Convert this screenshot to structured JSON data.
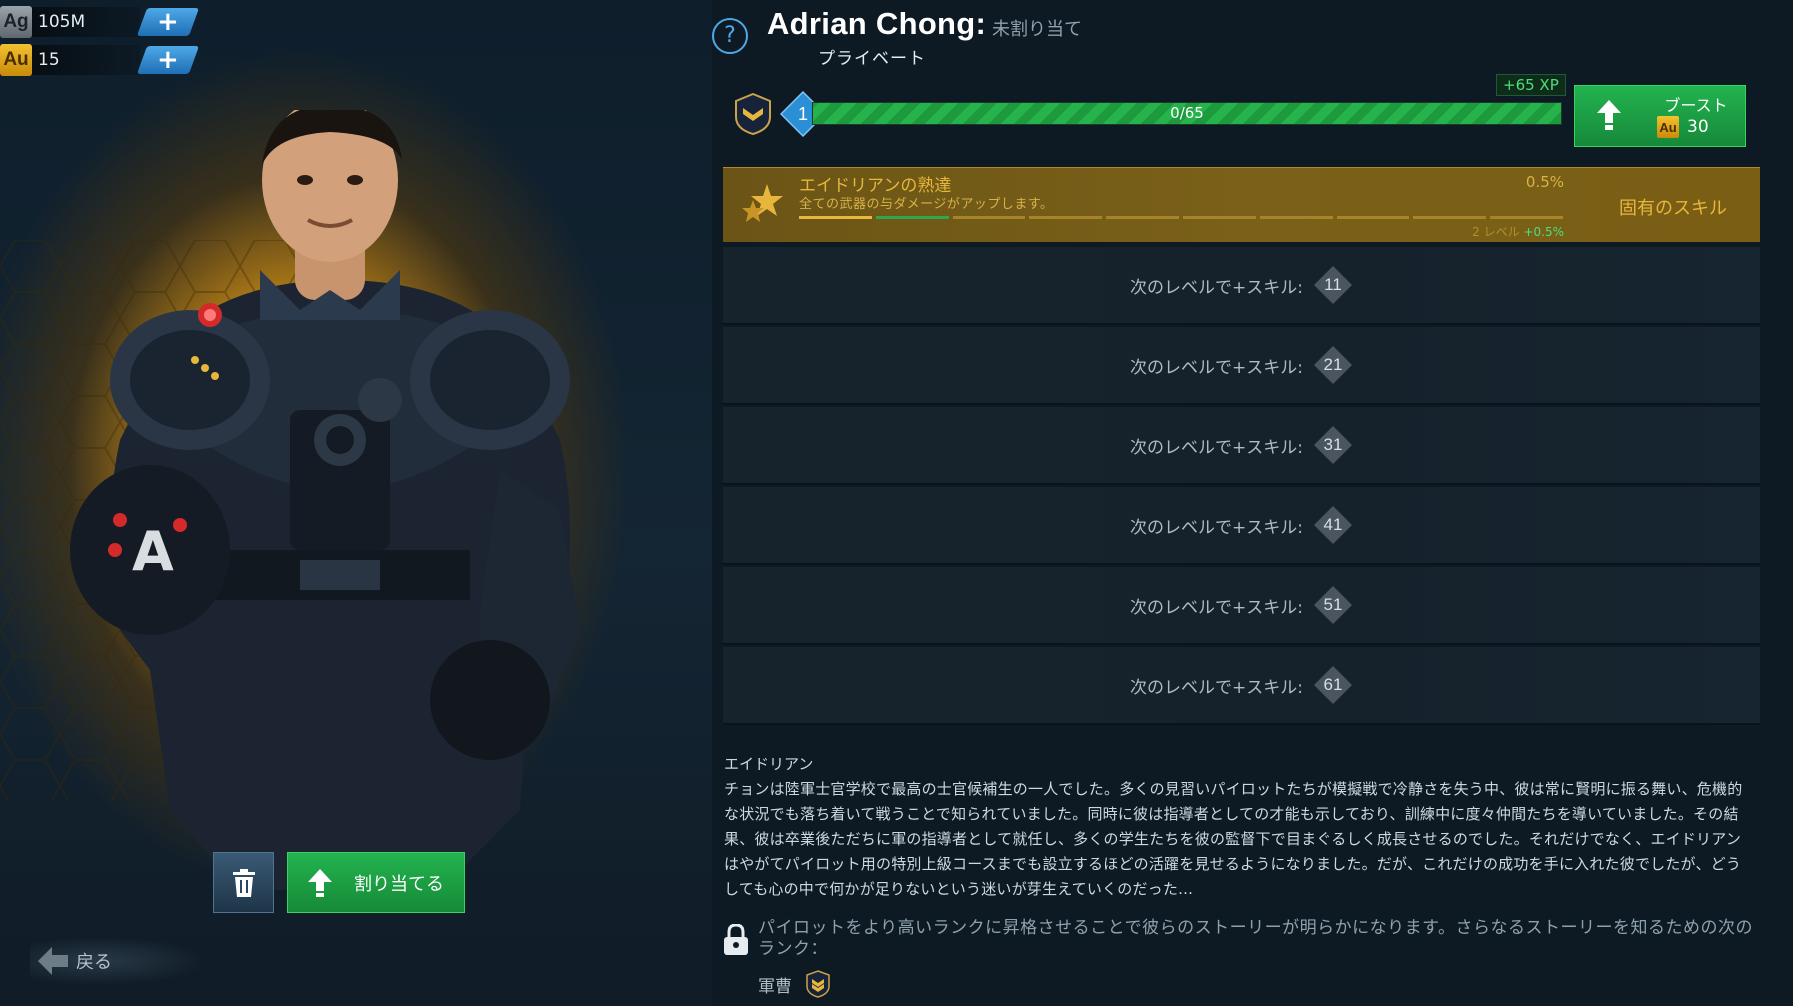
{
  "resources": [
    {
      "code": "Ag",
      "amount": "105M"
    },
    {
      "code": "Au",
      "amount": "15"
    }
  ],
  "pilot": {
    "name": "Adrian Chong:",
    "status": "未割り当て",
    "rank": "プライベート"
  },
  "xp": {
    "level": "1",
    "progress_text": "0/65",
    "fill_fraction": 0.0,
    "gain": "+65 XP"
  },
  "boost": {
    "label": "ブースト",
    "currency": "Au",
    "cost": "30"
  },
  "skill": {
    "title": "エイドリアンの熟達",
    "description": "全ての武器の与ダメージがアップします。",
    "value": "0.5%",
    "next_level": "2 レベル",
    "next_bonus": "+0.5%",
    "type": "固有のスキル",
    "segments_total": 10,
    "segments_filled": 2
  },
  "unlocks": [
    {
      "label": "次のレベルで+スキル:",
      "level": "11"
    },
    {
      "label": "次のレベルで+スキル:",
      "level": "21"
    },
    {
      "label": "次のレベルで+スキル:",
      "level": "31"
    },
    {
      "label": "次のレベルで+スキル:",
      "level": "41"
    },
    {
      "label": "次のレベルで+スキル:",
      "level": "51"
    },
    {
      "label": "次のレベルで+スキル:",
      "level": "61"
    }
  ],
  "bio": {
    "title": "エイドリアン",
    "text": "チョンは陸軍士官学校で最高の士官候補生の一人でした。多くの見習いパイロットたちが模擬戦で冷静さを失う中、彼は常に賢明に振る舞い、危機的な状況でも落ち着いて戦うことで知られていました。同時に彼は指導者としての才能も示しており、訓練中に度々仲間たちを導いていました。その結果、彼は卒業後ただちに軍の指導者として就任し、多くの学生たちを彼の監督下で目まぐるしく成長させるのでした。それだけでなく、エイドリアンはやがてパイロット用の特別上級コースまでも設立するほどの活躍を見せるようになりました。だが、これだけの成功を手に入れた彼でしたが、どうしても心の中で何かが足りないという迷いが芽生えていくのだった…"
  },
  "story_lock": {
    "message": "パイロットをより高いランクに昇格させることで彼らのストーリーが明らかになります。さらなるストーリーを知るための次のランク：",
    "next_rank": "軍曹"
  },
  "actions": {
    "assign_label": "割り当てる",
    "back_label": "戻る"
  },
  "colors": {
    "accent_blue": "#4ea8e6",
    "action_green": "#23b34f",
    "skill_gold": "#e6b73c"
  },
  "icons": [
    "plus-icon",
    "trash-icon",
    "up-arrow-icon",
    "back-arrow-icon",
    "help-icon",
    "rank-chevron-icon",
    "skill-star-icon",
    "lock-icon"
  ]
}
